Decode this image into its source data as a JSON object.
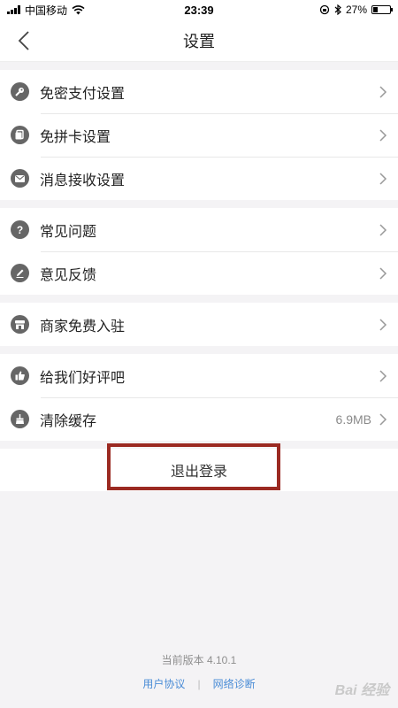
{
  "status_bar": {
    "carrier": "中国移动",
    "time": "23:39",
    "battery": "27%",
    "battery_level": 0.27
  },
  "nav": {
    "title": "设置",
    "back_icon": "chevron-left-icon"
  },
  "sections": [
    {
      "rows": [
        {
          "label": "免密支付设置",
          "icon": "key-icon"
        },
        {
          "label": "免拼卡设置",
          "icon": "card-icon"
        },
        {
          "label": "消息接收设置",
          "icon": "mail-icon"
        }
      ]
    },
    {
      "rows": [
        {
          "label": "常见问题",
          "icon": "question-icon"
        },
        {
          "label": "意见反馈",
          "icon": "pencil-icon"
        }
      ]
    },
    {
      "rows": [
        {
          "label": "商家免费入驻",
          "icon": "store-icon"
        }
      ]
    },
    {
      "rows": [
        {
          "label": "给我们好评吧",
          "icon": "thumbs-up-icon"
        },
        {
          "label": "清除缓存",
          "icon": "broom-icon",
          "value": "6.9MB"
        }
      ]
    }
  ],
  "logout": {
    "label": "退出登录"
  },
  "footer": {
    "version": "当前版本 4.10.1",
    "link_user_agreement": "用户协议",
    "separator": "|",
    "link_network_diagnosis": "网络诊断"
  },
  "watermark": "Bai 经验",
  "colors": {
    "highlight": "#9b2a22",
    "link": "#4a8cd6",
    "icon_bg": "#666666"
  }
}
